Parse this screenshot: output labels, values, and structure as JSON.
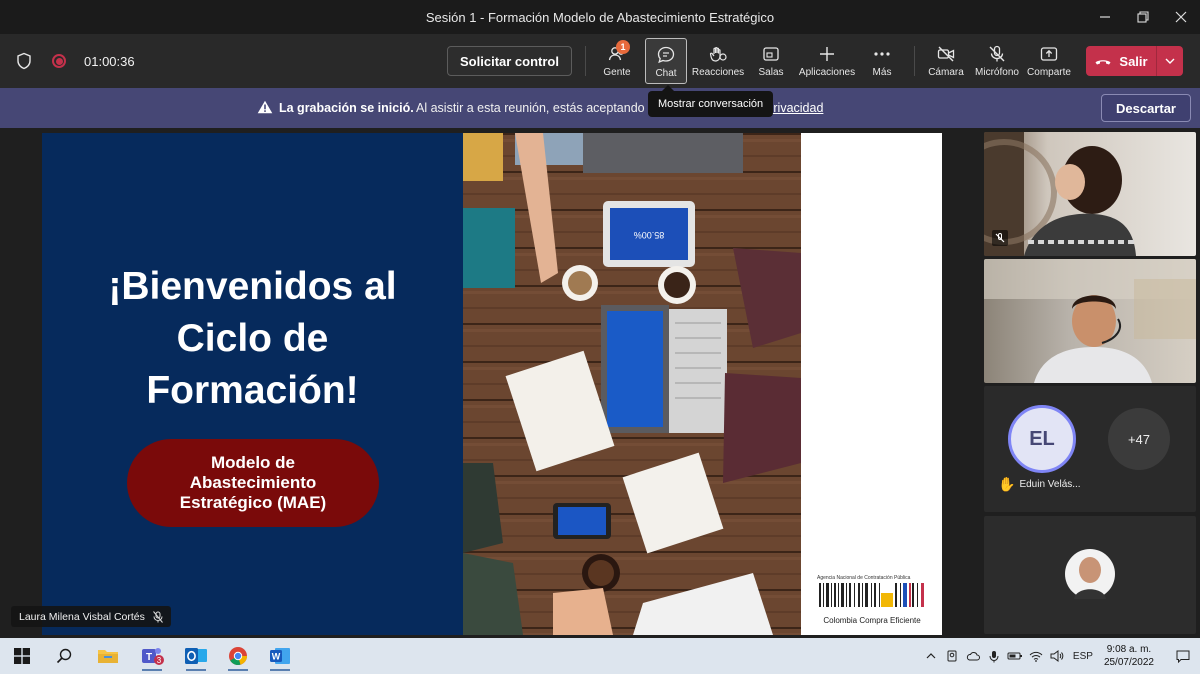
{
  "window": {
    "title": "Sesión 1 - Formación Modelo de Abastecimiento Estratégico"
  },
  "toolbar": {
    "timer": "01:00:36",
    "request_control": "Solicitar control",
    "people_badge": "1",
    "tools": {
      "people": "Gente",
      "chat": "Chat",
      "reactions": "Reacciones",
      "rooms": "Salas",
      "apps": "Aplicaciones",
      "more": "Más",
      "camera": "Cámara",
      "mic": "Micrófono",
      "share": "Comparte"
    },
    "leave": "Salir"
  },
  "tooltip": "Mostrar conversación",
  "banner": {
    "bold": "La grabación se inició.",
    "text": "Al asistir a esta reunión, estás aceptando se",
    "link": "e privacidad",
    "dismiss": "Descartar"
  },
  "slide": {
    "welcome_line1": "¡Bienvenidos al",
    "welcome_line2": "Ciclo de",
    "welcome_line3": "Formación!",
    "pill_line1": "Modelo de",
    "pill_line2": "Abastecimiento",
    "pill_line3": "Estratégico (MAE)",
    "tablet_text": "85.00%",
    "logo_small": "Agencia Nacional de Contratación Pública",
    "logo_name": "Colombia Compra Eficiente"
  },
  "presenter_name": "Laura Milena Visbal Cortés",
  "gallery": {
    "el_initials": "EL",
    "el_name": "Eduin Velás...",
    "more_count": "+47"
  },
  "taskbar": {
    "teams_badge": "3",
    "lang": "ESP",
    "time": "9:08 a. m.",
    "date": "25/07/2022"
  },
  "colors": {
    "leave": "#c4314b",
    "banner": "#464775",
    "slide_blue": "#062a5c",
    "pill_red": "#7a0a0a"
  }
}
